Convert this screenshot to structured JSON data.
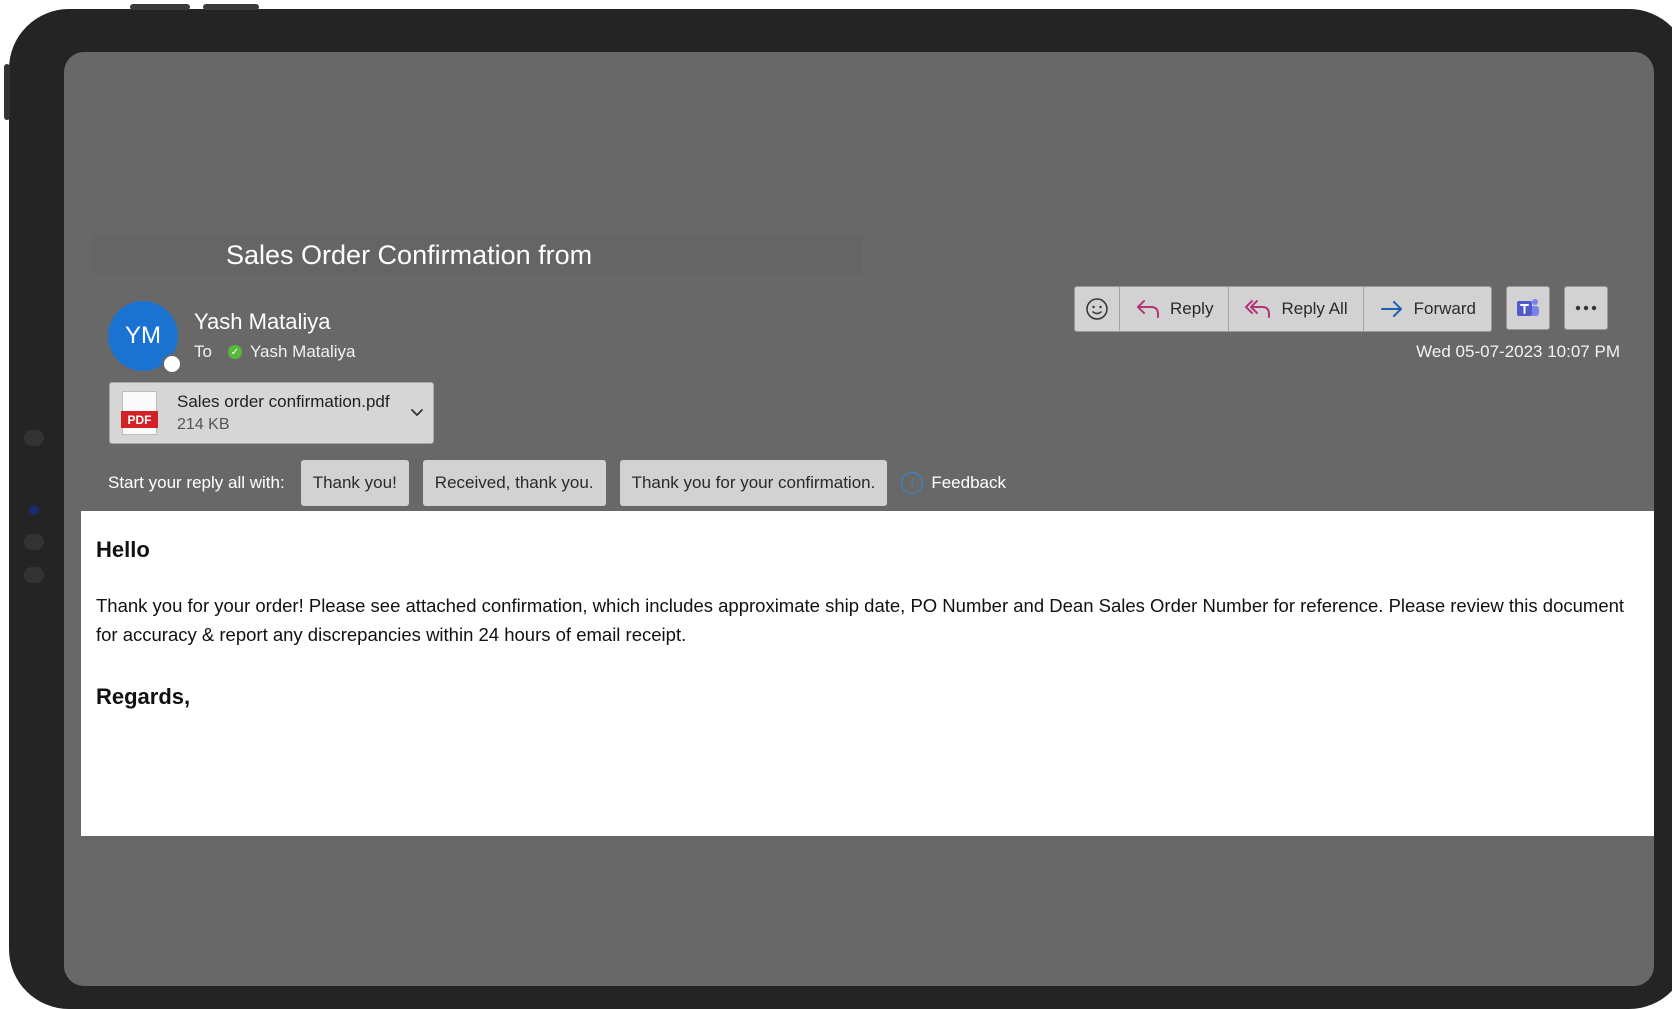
{
  "email": {
    "subject": "Sales Order Confirmation from",
    "sender": {
      "initials": "YM",
      "name": "Yash Mataliya"
    },
    "to_label": "To",
    "recipient": "Yash Mataliya",
    "datetime": "Wed 05-07-2023 10:07 PM",
    "attachment": {
      "filename": "Sales order confirmation.pdf",
      "size": "214 KB",
      "badge": "PDF"
    }
  },
  "toolbar": {
    "reply": "Reply",
    "reply_all": "Reply All",
    "forward": "Forward",
    "icons": [
      "emoji-icon",
      "reply-icon",
      "reply-all-icon",
      "forward-icon",
      "teams-icon",
      "more-icon"
    ]
  },
  "suggestions": {
    "label": "Start your reply all with:",
    "options": [
      "Thank you!",
      "Received, thank you.",
      "Thank you for your confirmation."
    ],
    "feedback": "Feedback"
  },
  "body": {
    "greeting": "Hello",
    "message": "Thank you for your order! Please see attached confirmation, which includes approximate ship date, PO Number and Dean Sales Order Number for reference. Please review this document for accuracy & report any discrepancies within 24 hours of email receipt.",
    "closing": "Regards,"
  },
  "colors": {
    "accent": "#1a73d1",
    "reply_icon": "#b2357a",
    "forward_icon": "#1f5fb0",
    "teams": "#5059c9",
    "pdf_red": "#d42027"
  }
}
